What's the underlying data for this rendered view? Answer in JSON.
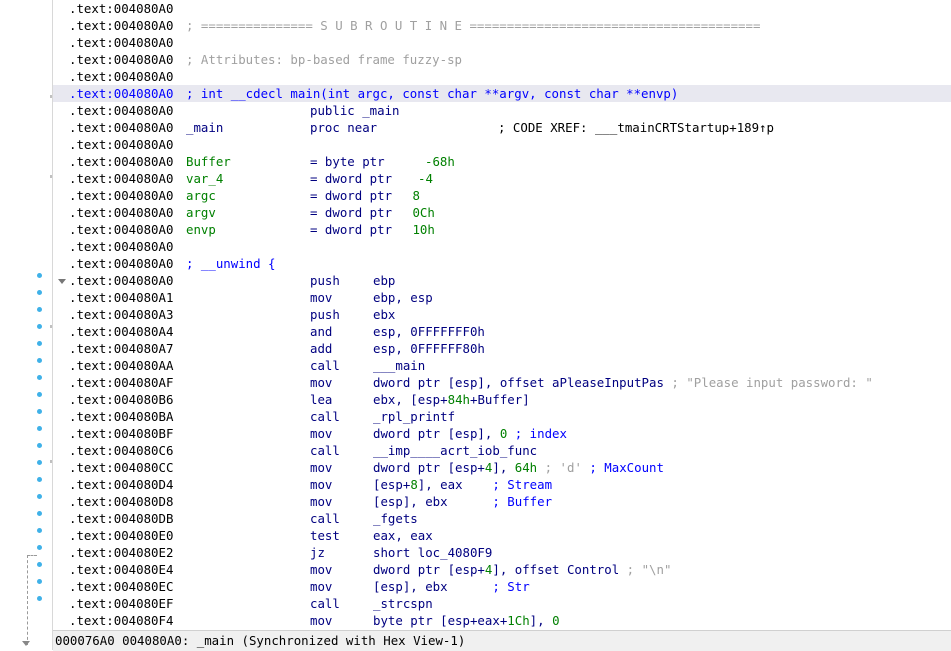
{
  "listing": {
    "r0": {
      "addr": ".text:004080A0"
    },
    "r1": {
      "addr": ".text:004080A0",
      "comment": "; =============== S U B R O U T I N E ======================================="
    },
    "r2": {
      "addr": ".text:004080A0"
    },
    "r3": {
      "addr": ".text:004080A0",
      "comment": "; Attributes: bp-based frame fuzzy-sp"
    },
    "r4": {
      "addr": ".text:004080A0"
    },
    "r5": {
      "addr": ".text:004080A0",
      "comment": "; int __cdecl main(int argc, const char **argv, const char **envp)"
    },
    "r6": {
      "addr": ".text:004080A0",
      "mn": "public _main"
    },
    "r7": {
      "addr": ".text:004080A0",
      "label": "_main",
      "mn": "proc near",
      "xref": "; CODE XREF: ___tmainCRTStartup+189↑p"
    },
    "r8": {
      "addr": ".text:004080A0"
    },
    "r9": {
      "addr": ".text:004080A0",
      "label": "Buffer",
      "mn": "= byte ptr",
      "num": "-68h"
    },
    "r10": {
      "addr": ".text:004080A0",
      "label": "var_4",
      "mn": "= dword ptr",
      "num": "-4"
    },
    "r11": {
      "addr": ".text:004080A0",
      "label": "argc",
      "mn": "= dword ptr",
      "num": " 8"
    },
    "r12": {
      "addr": ".text:004080A0",
      "label": "argv",
      "mn": "= dword ptr",
      "num": " 0Ch"
    },
    "r13": {
      "addr": ".text:004080A0",
      "label": "envp",
      "mn": "= dword ptr",
      "num": " 10h"
    },
    "r14": {
      "addr": ".text:004080A0"
    },
    "r15": {
      "addr": ".text:004080A0",
      "comment": "; __unwind {"
    },
    "r16": {
      "addr": ".text:004080A0",
      "mn": "push",
      "op": "ebp"
    },
    "r17": {
      "addr": ".text:004080A1",
      "mn": "mov",
      "op": "ebp, esp"
    },
    "r18": {
      "addr": ".text:004080A3",
      "mn": "push",
      "op": "ebx"
    },
    "r19": {
      "addr": ".text:004080A4",
      "mn": "and",
      "op": "esp, 0FFFFFFF0h"
    },
    "r20": {
      "addr": ".text:004080A7",
      "mn": "add",
      "op": "esp, 0FFFFFF80h"
    },
    "r21": {
      "addr": ".text:004080AA",
      "mn": "call",
      "op": "___main"
    },
    "r22": {
      "addr": ".text:004080AF",
      "mn": "mov",
      "op": "dword ptr [esp], offset aPleaseInputPas",
      "comment": " ; \"Please input password: \""
    },
    "r23": {
      "addr": ".text:004080B6",
      "mn": "lea",
      "op1": "ebx, [esp+",
      "op2": "84h",
      "op3": "+Buffer]"
    },
    "r24": {
      "addr": ".text:004080BA",
      "mn": "call",
      "op": "_rpl_printf"
    },
    "r25": {
      "addr": ".text:004080BF",
      "mn": "mov",
      "op1": "dword ptr [esp], ",
      "op2": "0",
      "comment": " ; index"
    },
    "r26": {
      "addr": ".text:004080C6",
      "mn": "call",
      "op": "__imp____acrt_iob_func"
    },
    "r27": {
      "addr": ".text:004080CC",
      "mn": "mov",
      "op1": "dword ptr [esp+",
      "op2": "4",
      "op3": "], ",
      "op4": "64h",
      "comment1": " ; 'd'",
      "comment2": " ; MaxCount"
    },
    "r28": {
      "addr": ".text:004080D4",
      "mn": "mov",
      "op1": "[esp+",
      "op2": "8",
      "op3": "], eax",
      "comment": "    ; Stream"
    },
    "r29": {
      "addr": ".text:004080D8",
      "mn": "mov",
      "op": "[esp], ebx",
      "comment": "      ; Buffer"
    },
    "r30": {
      "addr": ".text:004080DB",
      "mn": "call",
      "op": "_fgets"
    },
    "r31": {
      "addr": ".text:004080E0",
      "mn": "test",
      "op": "eax, eax"
    },
    "r32": {
      "addr": ".text:004080E2",
      "mn": "jz",
      "op": "short loc_4080F9"
    },
    "r33": {
      "addr": ".text:004080E4",
      "mn": "mov",
      "op1": "dword ptr [esp+",
      "op2": "4",
      "op3": "], offset Control",
      "comment": " ; \"\\n\""
    },
    "r34": {
      "addr": ".text:004080EC",
      "mn": "mov",
      "op": "[esp], ebx",
      "comment": "      ; Str"
    },
    "r35": {
      "addr": ".text:004080EF",
      "mn": "call",
      "op": "_strcspn"
    },
    "r36": {
      "addr": ".text:004080F4",
      "mn": "mov",
      "op1": "byte ptr [esp+eax+",
      "op2": "1Ch",
      "op3": "], ",
      "op4": "0"
    }
  },
  "status": {
    "text": "000076A0 004080A0: _main (Synchronized with Hex View-1)"
  },
  "colors": {
    "address": "#000000",
    "mnemonic": "#000080",
    "comment": "#0000ff",
    "number": "#008000",
    "highlight": "#e8e8f0",
    "breakpoint_dot": "#3fb1e8"
  }
}
